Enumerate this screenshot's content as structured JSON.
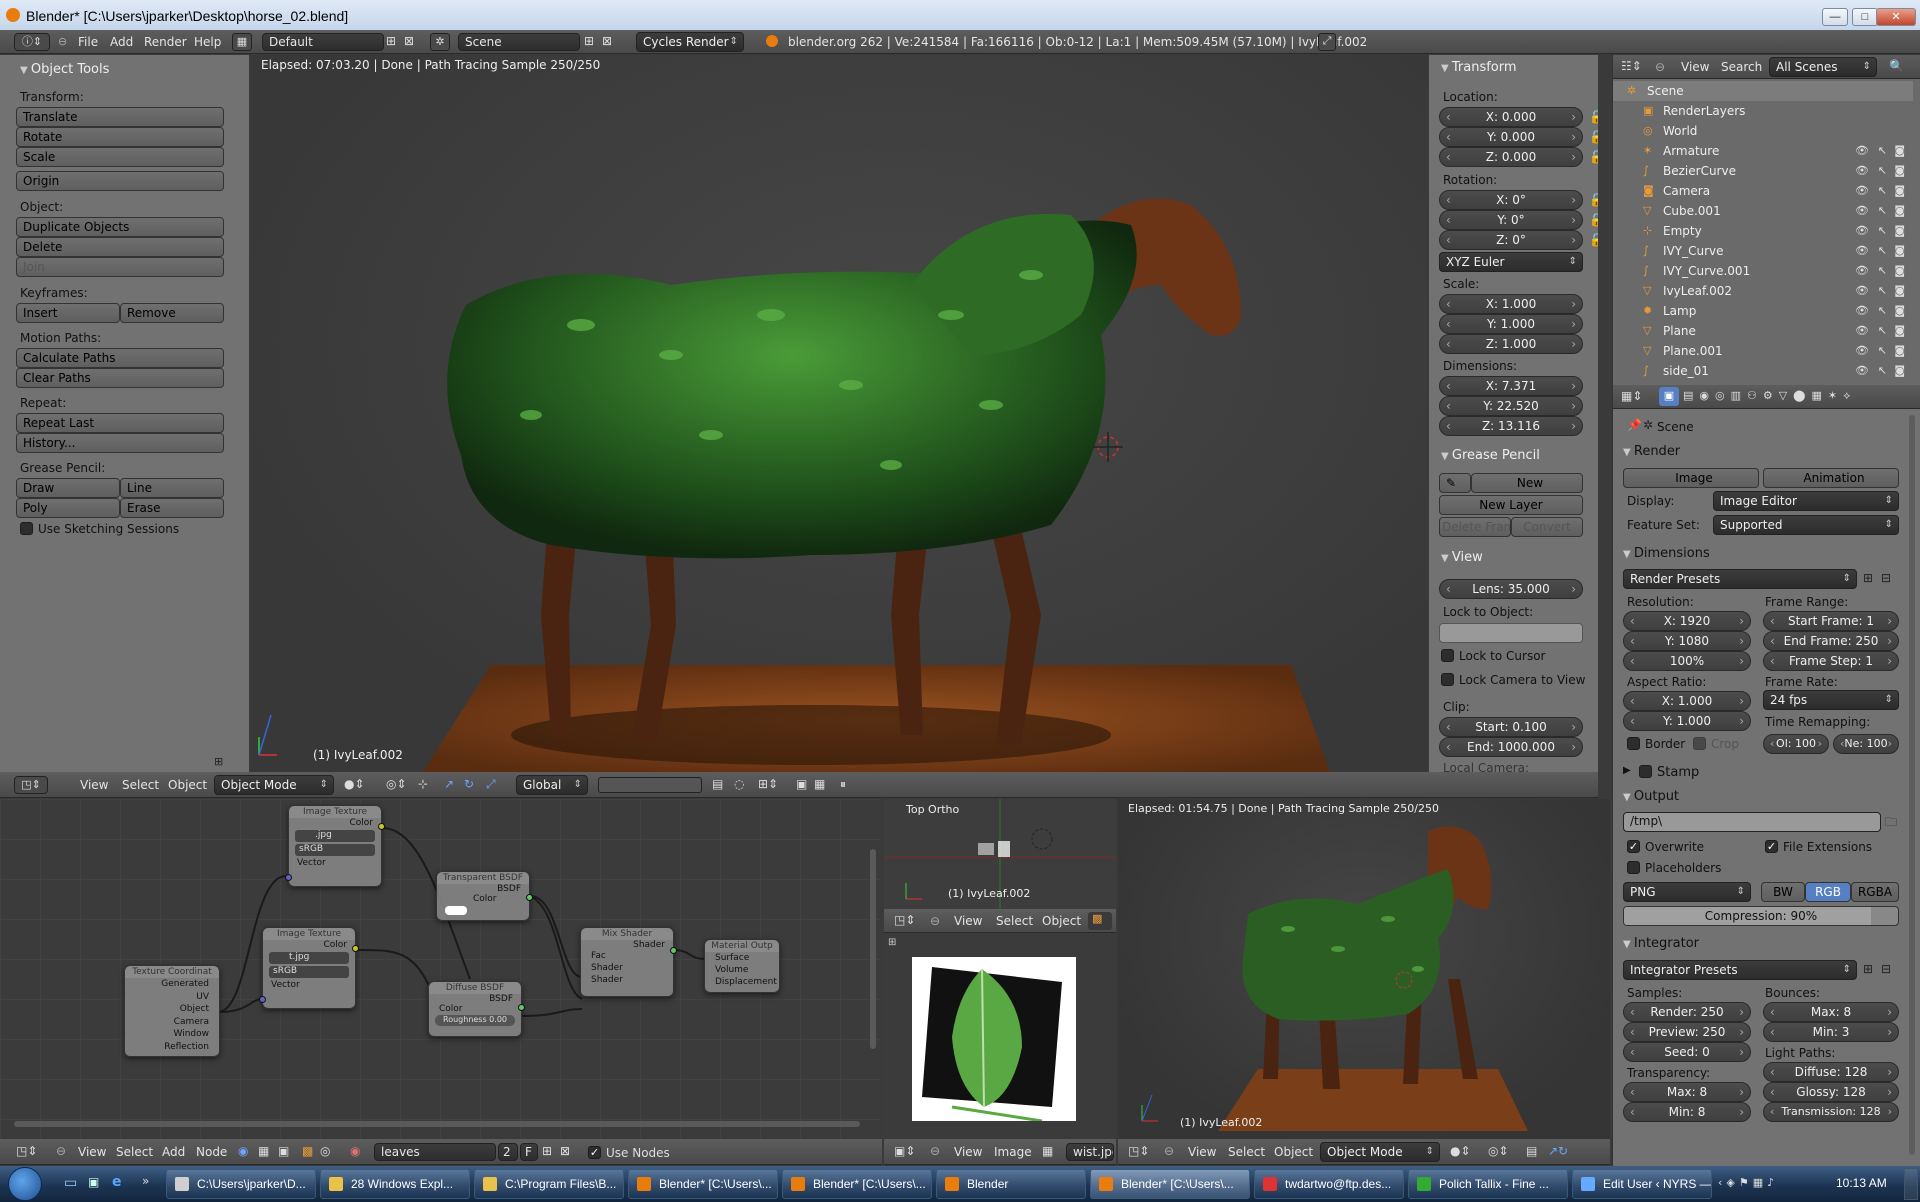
{
  "window": {
    "title": "Blender* [C:\\Users\\jparker\\Desktop\\horse_02.blend]",
    "minimize": "—",
    "maximize": "□",
    "close": "✕"
  },
  "topbar": {
    "menus": [
      "File",
      "Add",
      "Render",
      "Help"
    ],
    "layout": "Default",
    "scene": "Scene",
    "engine": "Cycles Render",
    "stats": "blender.org 262 | Ve:241584 | Fa:166116 | Ob:0-12 | La:1 | Mem:509.45M (57.10M) | IvyLeaf.002"
  },
  "tool_shelf": {
    "title": "Object Tools",
    "transform_label": "Transform:",
    "translate": "Translate",
    "rotate": "Rotate",
    "scale": "Scale",
    "origin": "Origin",
    "object_label": "Object:",
    "duplicate": "Duplicate Objects",
    "delete": "Delete",
    "join": "Join",
    "keyframes_label": "Keyframes:",
    "insert": "Insert",
    "remove": "Remove",
    "motion_label": "Motion Paths:",
    "calc_paths": "Calculate Paths",
    "clear_paths": "Clear Paths",
    "repeat_label": "Repeat:",
    "repeat_last": "Repeat Last",
    "history": "History...",
    "grease_label": "Grease Pencil:",
    "draw": "Draw",
    "line": "Line",
    "poly": "Poly",
    "erase": "Erase",
    "sketching": "Use Sketching Sessions"
  },
  "viewport": {
    "status": "Elapsed: 07:03.20 | Done | Path Tracing Sample 250/250",
    "object_label": "(1) IvyLeaf.002",
    "header": {
      "view": "View",
      "select": "Select",
      "object": "Object",
      "mode": "Object Mode",
      "orientation": "Global"
    }
  },
  "properties_n": {
    "transform": "Transform",
    "location_label": "Location:",
    "loc": [
      "X: 0.000",
      "Y: 0.000",
      "Z: 0.000"
    ],
    "rotation_label": "Rotation:",
    "rot": [
      "X: 0°",
      "Y: 0°",
      "Z: 0°"
    ],
    "rot_mode": "XYZ Euler",
    "scale_label": "Scale:",
    "scale": [
      "X: 1.000",
      "Y: 1.000",
      "Z: 1.000"
    ],
    "dims_label": "Dimensions:",
    "dims": [
      "X: 7.371",
      "Y: 22.520",
      "Z: 13.116"
    ],
    "grease": "Grease Pencil",
    "new": "New",
    "new_layer": "New Layer",
    "delete_frame": "Delete Frame",
    "convert": "Convert",
    "view": "View",
    "lens": "Lens: 35.000",
    "lock_obj_label": "Lock to Object:",
    "lock_cursor": "Lock to Cursor",
    "lock_camera": "Lock Camera to View",
    "clip_label": "Clip:",
    "clip_start": "Start: 0.100",
    "clip_end": "End: 1000.000",
    "local_camera": "Local Camera:"
  },
  "outliner": {
    "view": "View",
    "search": "Search",
    "filter": "All Scenes",
    "items": [
      {
        "name": "Scene",
        "icon": "scene-icon"
      },
      {
        "name": "RenderLayers",
        "icon": "render-layers-icon"
      },
      {
        "name": "World",
        "icon": "world-icon"
      },
      {
        "name": "Armature",
        "icon": "armature-icon"
      },
      {
        "name": "BezierCurve",
        "icon": "curve-icon"
      },
      {
        "name": "Camera",
        "icon": "camera-icon"
      },
      {
        "name": "Cube.001",
        "icon": "mesh-icon"
      },
      {
        "name": "Empty",
        "icon": "empty-icon"
      },
      {
        "name": "IVY_Curve",
        "icon": "curve-icon"
      },
      {
        "name": "IVY_Curve.001",
        "icon": "curve-icon"
      },
      {
        "name": "IvyLeaf.002",
        "icon": "mesh-icon"
      },
      {
        "name": "Lamp",
        "icon": "lamp-icon"
      },
      {
        "name": "Plane",
        "icon": "mesh-icon"
      },
      {
        "name": "Plane.001",
        "icon": "mesh-icon"
      },
      {
        "name": "side_01",
        "icon": "curve-icon"
      }
    ]
  },
  "render_props": {
    "scene": "Scene",
    "render": "Render",
    "image_btn": "Image",
    "animation_btn": "Animation",
    "display_label": "Display:",
    "display": "Image Editor",
    "feature_label": "Feature Set:",
    "feature": "Supported",
    "dimensions": "Dimensions",
    "presets": "Render Presets",
    "resolution_label": "Resolution:",
    "res_x": "X: 1920",
    "res_y": "Y: 1080",
    "res_pct": "100%",
    "frame_range_label": "Frame Range:",
    "start_frame": "Start Frame: 1",
    "end_frame": "End Frame: 250",
    "frame_step": "Frame Step: 1",
    "aspect_label": "Aspect Ratio:",
    "asp_x": "X: 1.000",
    "asp_y": "Y: 1.000",
    "frame_rate_label": "Frame Rate:",
    "fps": "24 fps",
    "time_remap_label": "Time Remapping:",
    "border": "Border",
    "crop": "Crop",
    "old": "Ol: 100",
    "new": "Ne: 100",
    "stamp": "Stamp",
    "output": "Output",
    "path": "/tmp\\",
    "overwrite": "Overwrite",
    "file_ext": "File Extensions",
    "placeholders": "Placeholders",
    "format": "PNG",
    "bw": "BW",
    "rgb": "RGB",
    "rgba": "RGBA",
    "compression": "Compression: 90%",
    "compression_value": 0.9,
    "integrator": "Integrator",
    "integrator_presets": "Integrator Presets",
    "samples_label": "Samples:",
    "render_s": "Render: 250",
    "preview_s": "Preview: 250",
    "seed": "Seed: 0",
    "bounces_label": "Bounces:",
    "max_b": "Max: 8",
    "min_b": "Min: 3",
    "transparency_label": "Transparency:",
    "t_max": "Max: 8",
    "t_min": "Min: 8",
    "light_paths_label": "Light Paths:",
    "diffuse": "Diffuse: 128",
    "glossy": "Glossy: 128",
    "transmission": "Transmission: 128"
  },
  "node_editor": {
    "menus": [
      "View",
      "Select",
      "Add",
      "Node"
    ],
    "material": "leaves",
    "users": "2",
    "fake": "F",
    "use_nodes": "Use Nodes",
    "nodes": {
      "img1": {
        "title": "Image Texture",
        "out": "Color",
        "file": ".jpg",
        "space": "sRGB",
        "in": "Vector"
      },
      "img2": {
        "title": "Image Texture",
        "out": "Color",
        "file": "t.jpg",
        "space": "sRGB",
        "in": "Vector"
      },
      "texcoord": {
        "title": "Texture Coordinat",
        "outs": [
          "Generated",
          "UV",
          "Object",
          "Camera",
          "Window",
          "Reflection"
        ]
      },
      "transparent": {
        "title": "Transparent BSDF",
        "out": "BSDF",
        "in": "Color"
      },
      "diffuse": {
        "title": "Diffuse BSDF",
        "out": "BSDF",
        "in": "Color",
        "rough": "Roughness 0.00"
      },
      "mix": {
        "title": "Mix Shader",
        "out": "Shader",
        "ins": [
          "Fac",
          "Shader",
          "Shader"
        ]
      },
      "output": {
        "title": "Material Outp",
        "ins": [
          "Surface",
          "Volume",
          "Displacement"
        ]
      }
    }
  },
  "top_ortho": {
    "label": "Top Ortho",
    "object": "(1) IvyLeaf.002"
  },
  "image_editor": {
    "view": "View",
    "image": "Image",
    "file": "wist.jpg"
  },
  "small_view": {
    "status": "Elapsed: 01:54.75 | Done | Path Tracing Sample 250/250",
    "object": "(1) IvyLeaf.002",
    "view": "View",
    "select": "Select",
    "object_menu": "Object",
    "mode": "Object Mode"
  },
  "mid_header": {
    "view": "View",
    "select": "Select",
    "object": "Object"
  },
  "taskbar": {
    "items": [
      "C:\\Users\\jparker\\D...",
      "28 Windows Expl...",
      "C:\\Program Files\\B...",
      "Blender* [C:\\Users\\...",
      "Blender* [C:\\Users\\...",
      "Blender",
      "Blender* [C:\\Users\\...",
      "twdartwo@ftp.des...",
      "Polich Tallix - Fine ...",
      "Edit User ‹ NYRS — ..."
    ],
    "clock": "10:13 AM"
  },
  "colors": {
    "accent": "#5680c2",
    "ui_bg": "#727272",
    "viewport_bg": "#3d3d3d",
    "leaf_green": "#2f7a2a",
    "rust": "#8a4a1e"
  }
}
